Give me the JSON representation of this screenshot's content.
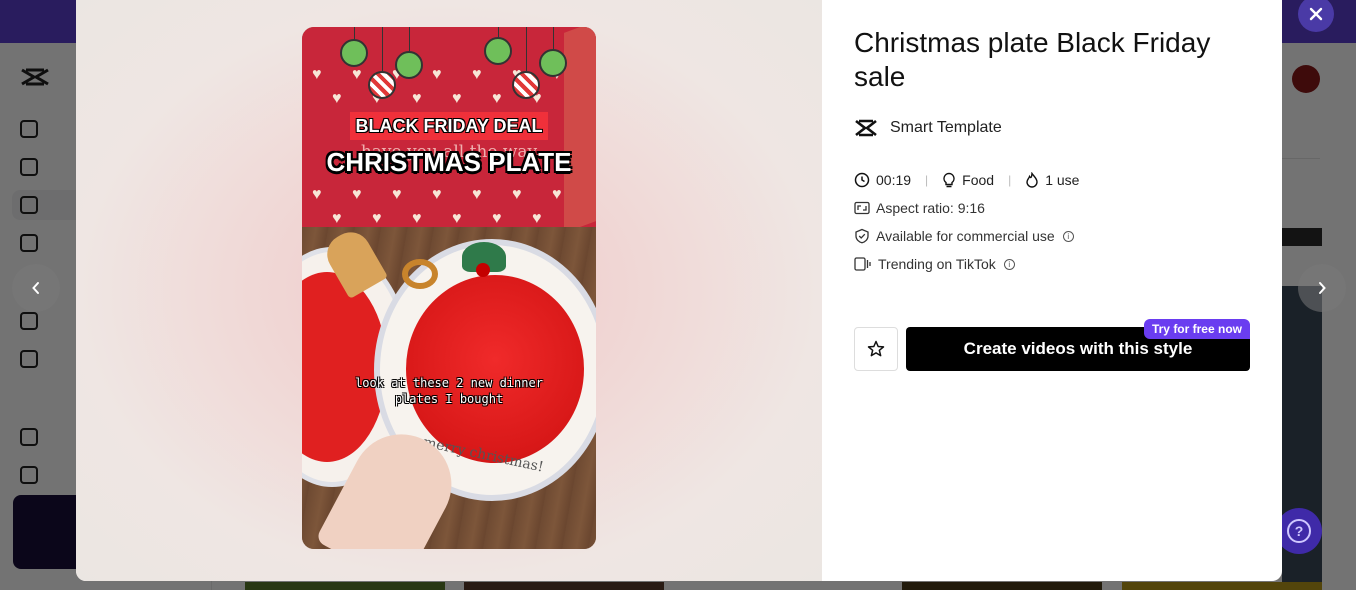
{
  "modal": {
    "title": "Christmas plate Black Friday sale",
    "template_type": "Smart Template",
    "meta": {
      "duration": "00:19",
      "category": "Food",
      "uses": "1 use"
    },
    "features": [
      "Aspect ratio: 9:16",
      "Available for commercial use",
      "Trending on TikTok"
    ],
    "create_button": "Create videos with this style",
    "try_badge": "Try for free now",
    "video": {
      "tag": "BLACK FRIDAY DEAL",
      "headline": "CHRISTMAS PLATE",
      "ghost_text": "have you all the way",
      "caption": "look at these 2 new dinner plates I bought",
      "plate_text": "merry christmas!"
    }
  },
  "icons": {
    "close": "close-icon",
    "prev": "chevron-left-icon",
    "next": "chevron-right-icon",
    "favorite": "star-icon",
    "clock": "clock-icon",
    "category": "bulb-icon",
    "uses": "flame-icon",
    "aspect": "aspect-ratio-icon",
    "commercial": "shield-check-icon",
    "trending": "tiktok-icon"
  },
  "colors": {
    "accent": "#6a3df0",
    "primary_button": "#000000",
    "topbar": "#5b3fd0"
  }
}
